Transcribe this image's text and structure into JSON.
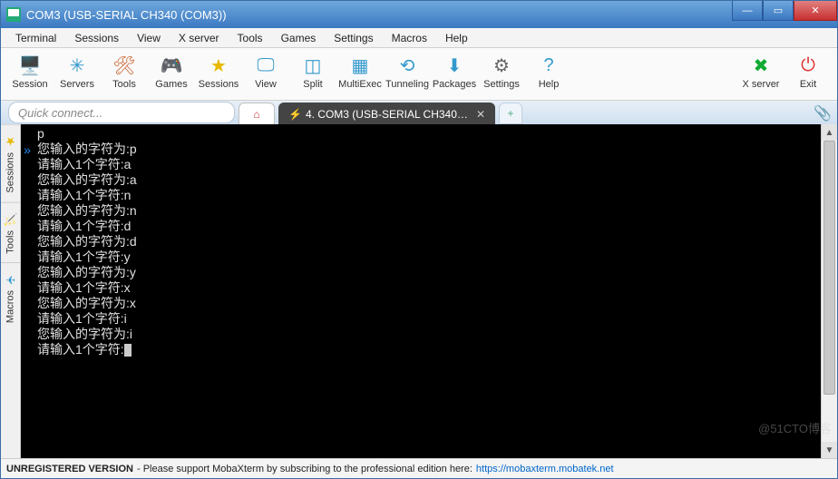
{
  "window": {
    "title": "COM3  (USB-SERIAL CH340 (COM3))"
  },
  "menu": [
    "Terminal",
    "Sessions",
    "View",
    "X server",
    "Tools",
    "Games",
    "Settings",
    "Macros",
    "Help"
  ],
  "toolbar": [
    {
      "label": "Session",
      "icon": "🖥️",
      "color": "#2a7"
    },
    {
      "label": "Servers",
      "icon": "✳",
      "color": "#39c"
    },
    {
      "label": "Tools",
      "icon": "🛠",
      "color": "#c63"
    },
    {
      "label": "Games",
      "icon": "🎮",
      "color": "#888"
    },
    {
      "label": "Sessions",
      "icon": "★",
      "color": "#e6b800"
    },
    {
      "label": "View",
      "icon": "🖵",
      "color": "#39c"
    },
    {
      "label": "Split",
      "icon": "◫",
      "color": "#39c"
    },
    {
      "label": "MultiExec",
      "icon": "▦",
      "color": "#39c"
    },
    {
      "label": "Tunneling",
      "icon": "⟲",
      "color": "#39c"
    },
    {
      "label": "Packages",
      "icon": "⬇",
      "color": "#39c"
    },
    {
      "label": "Settings",
      "icon": "⚙",
      "color": "#666"
    },
    {
      "label": "Help",
      "icon": "?",
      "color": "#39c"
    }
  ],
  "toolbar_right": [
    {
      "label": "X server",
      "icon": "✖",
      "color": "#1a3"
    },
    {
      "label": "Exit",
      "icon": "⏻",
      "color": "#d33"
    }
  ],
  "quick_connect_placeholder": "Quick connect...",
  "tabs": {
    "home_icon": "⌂",
    "active": "4. COM3  (USB-SERIAL CH340 (CO",
    "add": "+"
  },
  "sidetabs": [
    {
      "label": "Sessions",
      "icon": "★",
      "ic_color": "#e6b800"
    },
    {
      "label": "Tools",
      "icon": "🪄",
      "ic_color": "#c33"
    },
    {
      "label": "Macros",
      "icon": "✈",
      "ic_color": "#39c"
    }
  ],
  "terminal_lines": [
    "p",
    "您输入的字符为:p",
    "",
    "请输入1个字符:a",
    "您输入的字符为:a",
    "",
    "请输入1个字符:n",
    "您输入的字符为:n",
    "",
    "请输入1个字符:d",
    "您输入的字符为:d",
    "",
    "请输入1个字符:y",
    "您输入的字符为:y",
    "",
    "请输入1个字符:x",
    "您输入的字符为:x",
    "",
    "请输入1个字符:i",
    "您输入的字符为:i",
    "",
    "请输入1个字符:"
  ],
  "status": {
    "bold": "UNREGISTERED VERSION",
    "text": "  -  Please support MobaXterm by subscribing to the professional edition here:",
    "link": "https://mobaxterm.mobatek.net"
  },
  "watermark": "@51CTO博客"
}
